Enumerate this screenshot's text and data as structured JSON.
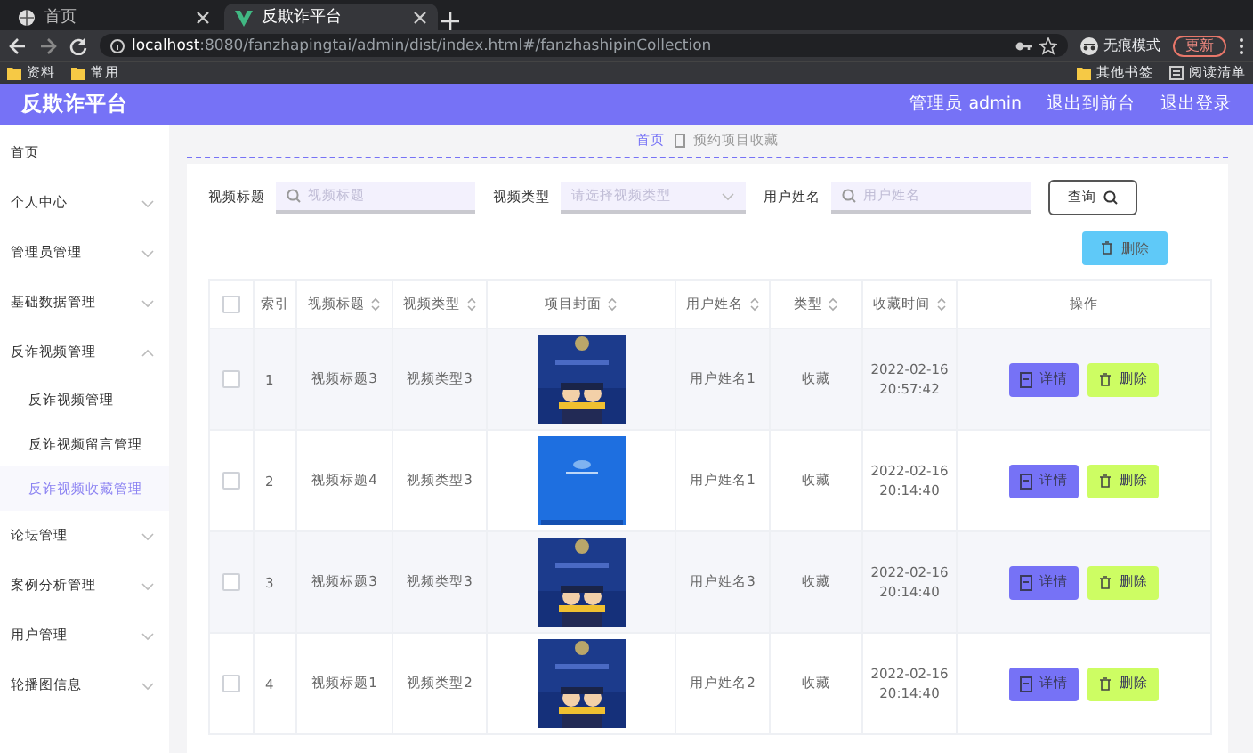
{
  "browser": {
    "tabs": [
      {
        "label": "首页",
        "selected": false
      },
      {
        "label": "反欺诈平台",
        "selected": true
      }
    ],
    "address": "localhost:8080/fanzhapingtai/admin/dist/index.html#/fanzhashipinCollection",
    "profile": "无痕模式",
    "update_button": "更新",
    "bookmarks": [
      "资料",
      "常用"
    ],
    "bookmarks_right": [
      "其他书签",
      "阅读清单"
    ]
  },
  "header": {
    "title": "反欺诈平台",
    "links": [
      "管理员 admin",
      "退出到前台",
      "退出登录"
    ]
  },
  "sidebar": {
    "items": [
      {
        "label": "首页",
        "kind": "link"
      },
      {
        "label": "个人中心",
        "kind": "group",
        "expanded": false
      },
      {
        "label": "管理员管理",
        "kind": "group",
        "expanded": false
      },
      {
        "label": "基础数据管理",
        "kind": "group",
        "expanded": false
      },
      {
        "label": "反诈视频管理",
        "kind": "group",
        "expanded": true,
        "children": [
          {
            "label": "反诈视频管理",
            "selected": false
          },
          {
            "label": "反诈视频留言管理",
            "selected": false
          },
          {
            "label": "反诈视频收藏管理",
            "selected": true
          }
        ]
      },
      {
        "label": "论坛管理",
        "kind": "group",
        "expanded": false
      },
      {
        "label": "案例分析管理",
        "kind": "group",
        "expanded": false
      },
      {
        "label": "用户管理",
        "kind": "group",
        "expanded": false
      },
      {
        "label": "轮播图信息",
        "kind": "group",
        "expanded": false
      }
    ]
  },
  "breadcrumb": [
    "首页",
    "预约项目收藏"
  ],
  "filters": [
    {
      "label": "视频标题",
      "kind": "input",
      "placeholder": "视频标题"
    },
    {
      "label": "视频类型",
      "kind": "select",
      "placeholder": "请选择视频类型"
    },
    {
      "label": "用户姓名",
      "kind": "input",
      "placeholder": "用户姓名"
    }
  ],
  "search_button": "查询",
  "delete_button": "删除",
  "table": {
    "header_checked": false,
    "columns": [
      {
        "label": "索引",
        "sortable": false
      },
      {
        "label": "视频标题",
        "sortable": true
      },
      {
        "label": "视频类型",
        "sortable": true
      },
      {
        "label": "项目封面",
        "sortable": true
      },
      {
        "label": "用户姓名",
        "sortable": true
      },
      {
        "label": "类型",
        "sortable": true
      },
      {
        "label": "收藏时间",
        "sortable": true
      },
      {
        "label": "操作",
        "sortable": false
      }
    ],
    "rows": [
      {
        "checked": false,
        "index": "1",
        "title": "视频标题3",
        "type": "视频类型3",
        "user": "用户姓名1",
        "kind": "收藏",
        "time": [
          "2022-02-16",
          "20:57:42"
        ],
        "actions": [
          "详情",
          "删除"
        ]
      },
      {
        "checked": false,
        "index": "2",
        "title": "视频标题4",
        "type": "视频类型3",
        "user": "用户姓名1",
        "kind": "收藏",
        "time": [
          "2022-02-16",
          "20:14:40"
        ],
        "actions": [
          "详情",
          "删除"
        ]
      },
      {
        "checked": false,
        "index": "3",
        "title": "视频标题3",
        "type": "视频类型3",
        "user": "用户姓名3",
        "kind": "收藏",
        "time": [
          "2022-02-16",
          "20:14:40"
        ],
        "actions": [
          "详情",
          "删除"
        ]
      },
      {
        "checked": false,
        "index": "4",
        "title": "视频标题1",
        "type": "视频类型2",
        "user": "用户姓名2",
        "kind": "收藏",
        "time": [
          "2022-02-16",
          "20:14:40"
        ],
        "actions": [
          "详情",
          "删除"
        ]
      }
    ]
  }
}
